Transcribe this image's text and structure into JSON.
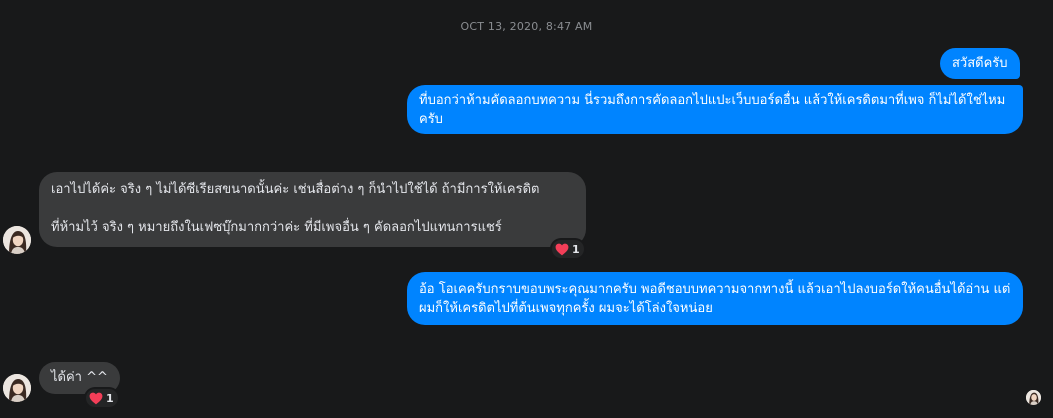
{
  "conversation": {
    "timestamp": "OCT 13, 2020, 8:47 AM",
    "messages": [
      {
        "sender": "me",
        "text": "สวัสดีครับ"
      },
      {
        "sender": "me",
        "text": "ที่บอกว่าห้ามคัดลอกบทความ นี่รวมถึงการคัดลอกไปแปะเว็บบอร์ดอื่น แล้วให้เครดิตมาที่เพจ ก็ไม่ได้ใช่ไหมครับ"
      },
      {
        "sender": "page",
        "text": "เอาไปได้ค่ะ จริง ๆ ไม่ได้ซีเรียสขนาดนั้นค่ะ เช่นสื่อต่าง ๆ ก็นำไปใช้ได้ ถ้ามีการให้เครดิต\n\nที่ห้ามไว้ จริง ๆ หมายถึงในเฟซบุ๊กมากกว่าค่ะ ที่มีเพจอื่น ๆ คัดลอกไปแทนการแชร์",
        "reaction": {
          "icon": "heart-icon",
          "count": "1"
        }
      },
      {
        "sender": "me",
        "text": "อ้อ โอเคครับกราบขอบพระคุณมากครับ พอดีชอบบทความจากทางนี้ แล้วเอาไปลงบอร์ดให้คนอื่นได้อ่าน แต่ผมก็ให้เครดิตไปที่ต้นเพจทุกครั้ง ผมจะได้โล่งใจหน่อย"
      },
      {
        "sender": "page",
        "text": "ได้ค่า ^^",
        "reaction": {
          "icon": "heart-icon",
          "count": "1"
        }
      }
    ]
  },
  "colors": {
    "background": "#18191a",
    "outgoing_bubble": "#0084ff",
    "incoming_bubble": "#3a3b3c",
    "heart": "#f33e58"
  }
}
